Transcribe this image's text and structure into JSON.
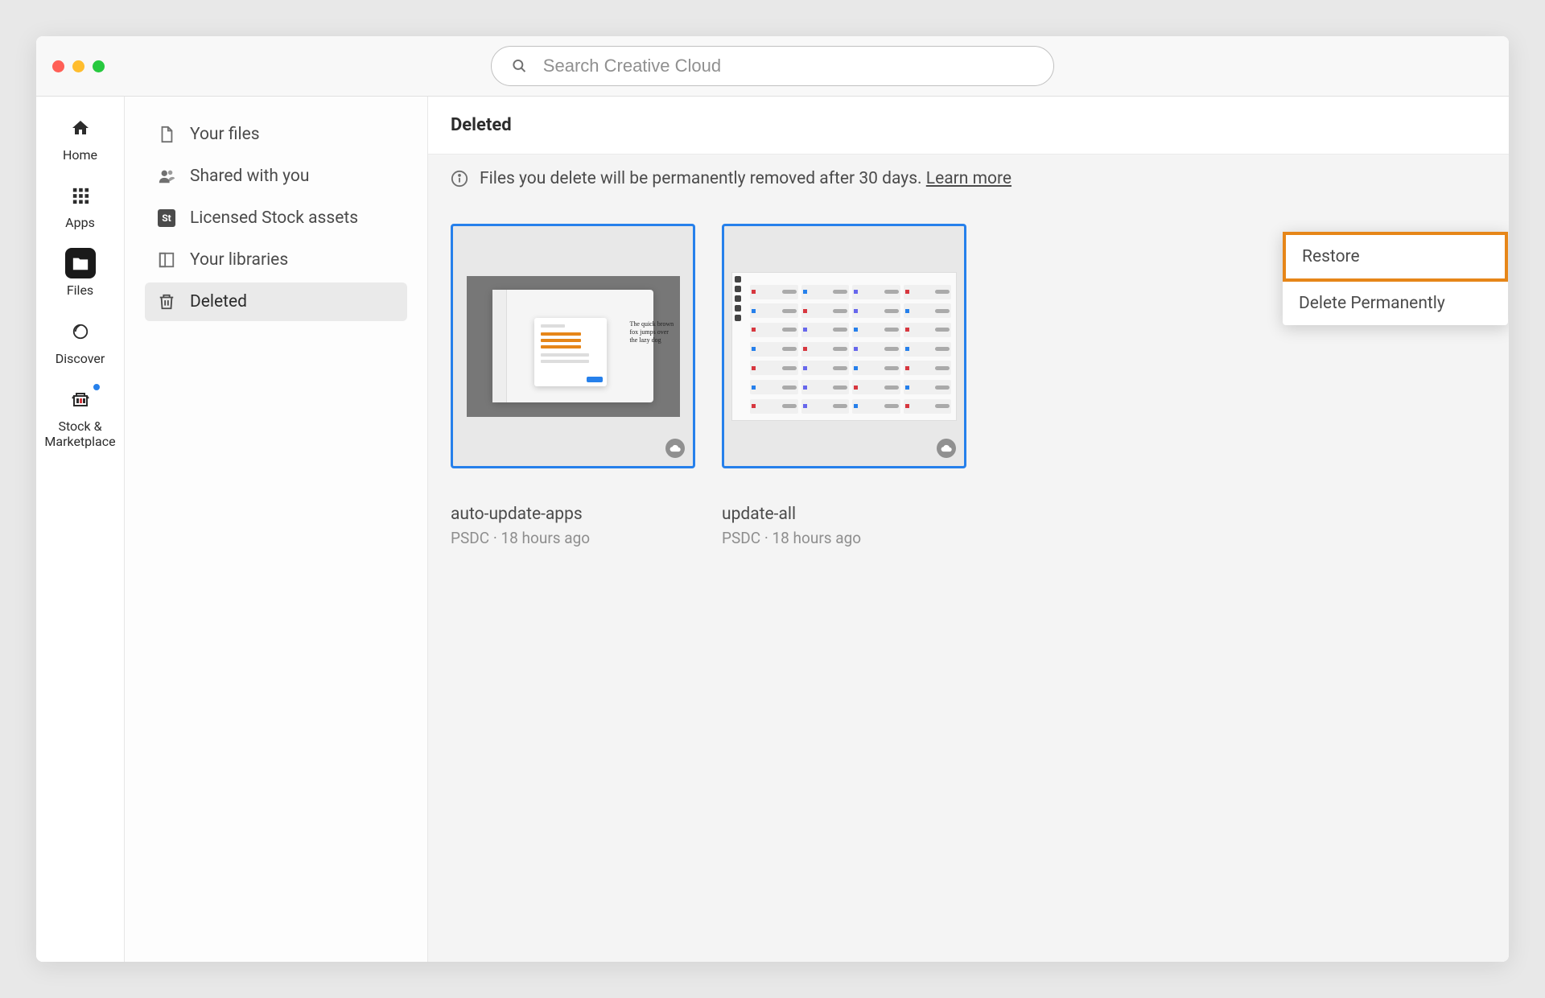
{
  "search": {
    "placeholder": "Search Creative Cloud"
  },
  "rail": {
    "home": "Home",
    "apps": "Apps",
    "files": "Files",
    "discover": "Discover",
    "stock": "Stock &\nMarketplace"
  },
  "sidebar": {
    "your_files": "Your files",
    "shared": "Shared with you",
    "stock_assets": "Licensed Stock assets",
    "libraries": "Your libraries",
    "deleted": "Deleted"
  },
  "main": {
    "title": "Deleted",
    "info_text": "Files you delete will be permanently removed after 30 days. ",
    "learn_more": "Learn more"
  },
  "files": [
    {
      "name": "auto-update-apps",
      "meta": "PSDC · 18 hours ago",
      "thumb_text": "The quick brown fox jumps over the lazy dog"
    },
    {
      "name": "update-all",
      "meta": "PSDC · 18 hours ago"
    }
  ],
  "context_menu": {
    "restore": "Restore",
    "delete_permanently": "Delete Permanently"
  }
}
